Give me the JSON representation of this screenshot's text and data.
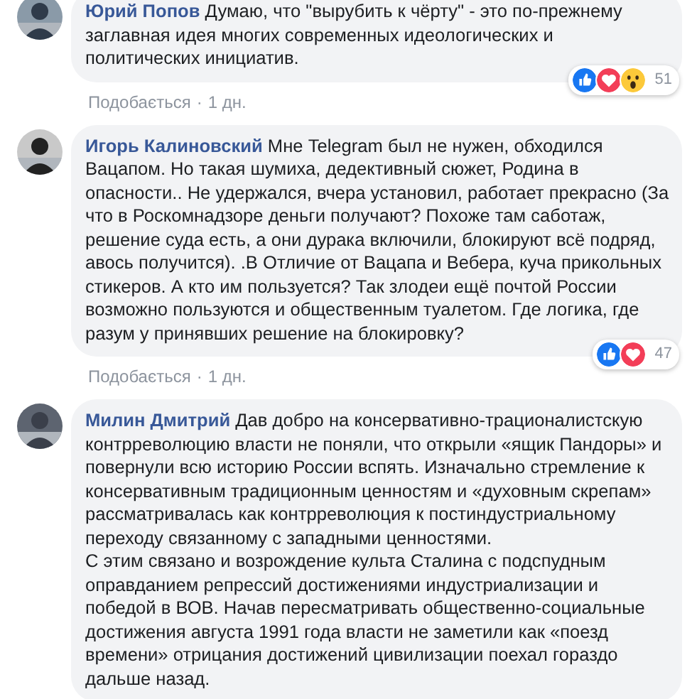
{
  "comments": [
    {
      "author": "Юрий Попов",
      "text": "Думаю, что \"вырубить к чёрту\" - это по-прежнему заглавная идея многих современных идеологических и политических инициатив.",
      "reactions": [
        {
          "kind": "like"
        },
        {
          "kind": "love"
        },
        {
          "kind": "wow"
        }
      ],
      "reaction_count": "51",
      "like_label": "Подобається",
      "separator": "·",
      "time": "1 дн."
    },
    {
      "author": "Игорь Калиновский",
      "text": "Мне Telegram был не нужен, обходился Вацапом. Но такая шумиха, дедективный сюжет, Родина в опасности.. Не удержался, вчера установил, работает прекрасно (За что в Роскомнадзоре деньги получают? Похоже там саботаж, решение суда есть, а они дурака включили, блокируют всё подряд, авось получится). .В Отличие от Вацапа и Вебера, куча прикольных стикеров. А кто им пользуется? Так злодеи ещё почтой России возможно пользуются и общественным туалетом. Где логика, где разум у принявших решение на блокировку?",
      "reactions": [
        {
          "kind": "like"
        },
        {
          "kind": "love"
        }
      ],
      "reaction_count": "47",
      "like_label": "Подобається",
      "separator": "·",
      "time": "1 дн."
    },
    {
      "author": "Милин Дмитрий",
      "text": "Дав добро на консервативно-трационалистскую контрреволюцию власти не поняли, что открыли «ящик Пандоры» и повернули всю историю России вспять. Изначально стремление к консервативным традиционным ценностям и «духовным скрепам» рассматривалась как контрреволюция к постиндустриальному переходу связанному с западными ценностями.\nС этим связано и возрождение культа Сталина с подспудным оправданием репрессий достижениями индустриализации и победой в ВОВ. Начав пересматривать общественно-социальные достижения августа 1991 года власти не заметили как «поезд времени» отрицания достижений цивилизации поехал гораздо дальше назад."
    }
  ]
}
